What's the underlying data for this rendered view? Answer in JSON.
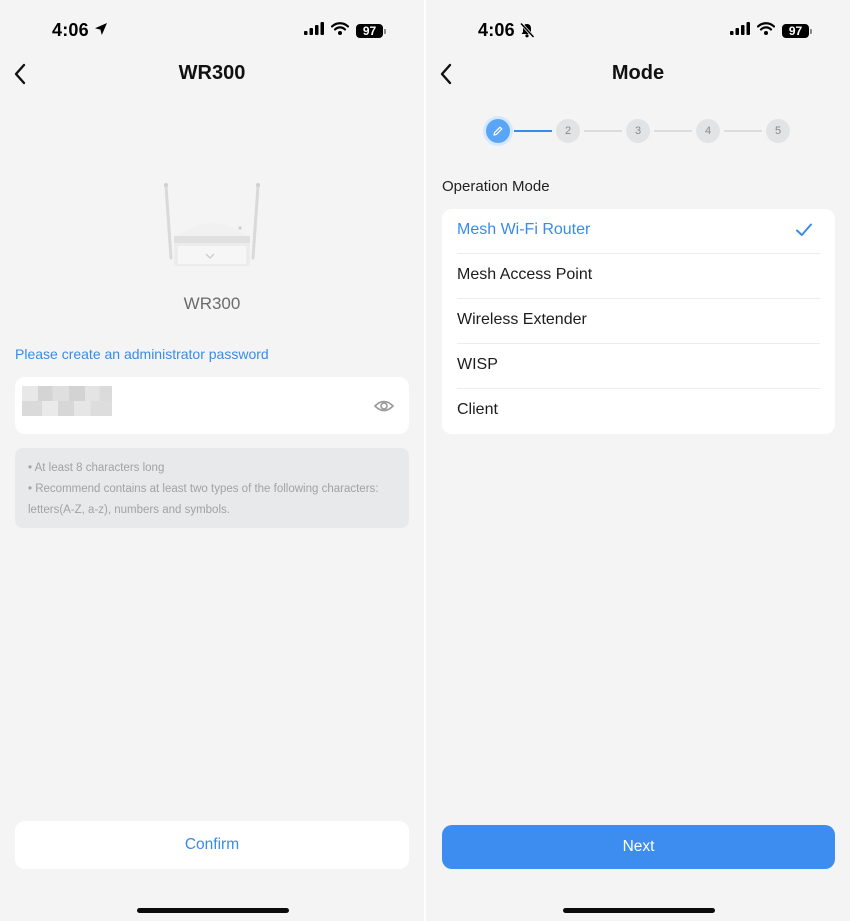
{
  "left_screen": {
    "status": {
      "time": "4:06",
      "battery": "97",
      "time_glyph": "location-arrow-icon"
    },
    "nav": {
      "title": "WR300",
      "back_icon": "chevron-left-icon"
    },
    "device": {
      "name": "WR300",
      "image": "router-image"
    },
    "password": {
      "prompt": "Please create an administrator password",
      "value_display": "masked/blurred",
      "toggle_icon": "eye-icon"
    },
    "hints": [
      "• At least 8 characters long",
      "• Recommend contains at least two types of the following characters: letters(A-Z, a-z), numbers and symbols."
    ],
    "confirm_label": "Confirm"
  },
  "right_screen": {
    "status": {
      "time": "4:06",
      "battery": "97",
      "time_glyph": "bell-slash-icon"
    },
    "nav": {
      "title": "Mode",
      "back_icon": "chevron-left-icon"
    },
    "stepper": {
      "current_step": 1,
      "current_step_icon": "pencil-icon",
      "steps": [
        "",
        "2",
        "3",
        "4",
        "5"
      ]
    },
    "section_label": "Operation Mode",
    "modes": [
      {
        "label": "Mesh Wi-Fi Router",
        "selected": true
      },
      {
        "label": "Mesh Access Point",
        "selected": false
      },
      {
        "label": "Wireless Extender",
        "selected": false
      },
      {
        "label": "WISP",
        "selected": false
      },
      {
        "label": "Client",
        "selected": false
      }
    ],
    "next_label": "Next"
  },
  "colors": {
    "accent": "#3a8be8",
    "primary_button": "#3d8cf0",
    "background": "#f4f4f4",
    "hint_box": "#e8e9eb"
  }
}
